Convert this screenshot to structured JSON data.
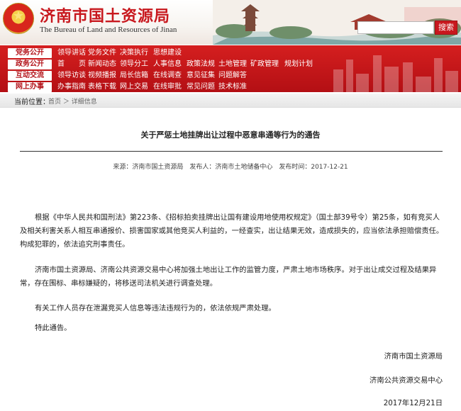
{
  "header": {
    "title": "济南市国土资源局",
    "subtitle": "The Bureau of Land and Resources of Jinan",
    "search_placeholder": "",
    "search_button": "搜索",
    "emblem_icon": "national-emblem-icon"
  },
  "nav": {
    "rows": [
      {
        "label": "党务公开",
        "links": [
          "领导讲话",
          "党务文件",
          "决策执行",
          "思想建设"
        ]
      },
      {
        "label": "政务公开",
        "links": [
          "首　　页",
          "新闻动态",
          "领导分工",
          "人事信息",
          "政策法规",
          "土地管理",
          "矿政管理",
          "规划计划"
        ]
      },
      {
        "label": "互动交流",
        "links": [
          "领导访谈",
          "视频播报",
          "局长信箱",
          "在线调查",
          "意见征集",
          "问题解答"
        ]
      },
      {
        "label": "网上办事",
        "links": [
          "办事指南",
          "表格下载",
          "网上交易",
          "在线审批",
          "常见问题",
          "技术标准"
        ]
      }
    ],
    "accent_color": "#c8181e"
  },
  "breadcrumb": {
    "label": "当前位置：",
    "trail": "首页 ＞ 详细信息"
  },
  "article": {
    "title": "关于严惩土地挂牌出让过程中恶意串通等行为的通告",
    "meta": "来源：济南市国土资源局　发布人：济南市土地储备中心　发布时间：2017-12-21",
    "paragraphs": [
      "根据《中华人民共和国刑法》第223条、《招标拍卖挂牌出让国有建设用地使用权规定》（国土部39号令）第25条，如有竞买人及相关利害关系人相互串通报价、损害国家或其他竞买人利益的，一经查实，出让结果无效，造成损失的，应当依法承担赔偿责任。构成犯罪的，依法追究刑事责任。",
      "济南市国土资源局、济南公共资源交易中心将加强土地出让工作的监管力度，严肃土地市场秩序。对于出让成交过程及结果异常，存在围标、串标嫌疑的，将移送司法机关进行调查处理。",
      "有关工作人员存在泄漏竞买人信息等违法违规行为的，依法依规严肃处理。",
      "特此通告。"
    ],
    "signatures": [
      "济南市国土资源局",
      "济南公共资源交易中心",
      "2017年12月21日"
    ]
  }
}
